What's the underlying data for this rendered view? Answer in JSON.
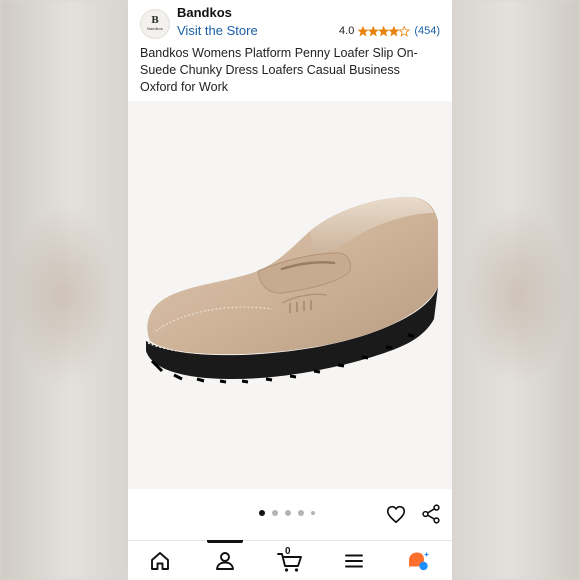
{
  "brand": {
    "logo_mark": "B",
    "logo_text": "Bandkos",
    "name": "Bandkos",
    "store_link": "Visit the Store"
  },
  "rating": {
    "score": "4.0",
    "count": "(454)",
    "stars_value": 4.0,
    "stars_max": 5,
    "star_color": "#e8820c"
  },
  "product": {
    "title": "Bandkos Womens Platform Penny Loafer Slip On-Suede Chunky Dress Loafers Casual Business Oxford for Work",
    "image_icon": "loafer-shoe-image"
  },
  "carousel": {
    "total_dots": 5,
    "active_index": 0
  },
  "actions": {
    "favorite_icon": "heart-icon",
    "share_icon": "share-icon"
  },
  "bottom_nav": {
    "items": [
      {
        "icon": "home-icon"
      },
      {
        "icon": "account-icon",
        "active": true
      },
      {
        "icon": "cart-icon",
        "count": "0"
      },
      {
        "icon": "menu-icon"
      },
      {
        "icon": "rufus-assistant-icon"
      }
    ]
  },
  "colors": {
    "link": "#1a5fa6",
    "accent_orange": "#e8820c",
    "assistant_orange": "#ff6f2c",
    "assistant_blue": "#1e8fff"
  }
}
